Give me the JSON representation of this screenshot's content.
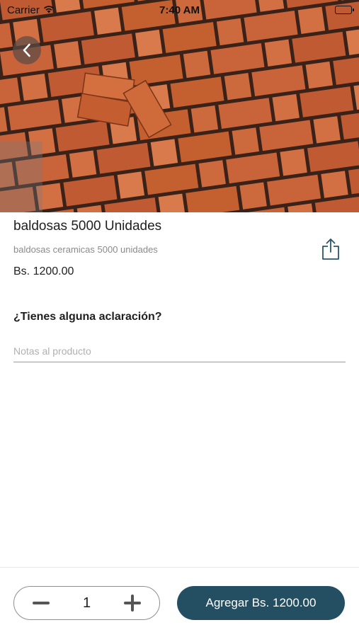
{
  "status_bar": {
    "carrier": "Carrier",
    "time": "7:40 AM",
    "icons": [
      "wifi-icon",
      "battery-icon"
    ]
  },
  "hero": {
    "image": "clay brick paving tiles photo"
  },
  "product": {
    "title": "baldosas 5000 Unidades",
    "description": "baldosas ceramicas 5000 unidades",
    "price": "Bs. 1200.00"
  },
  "notes": {
    "heading": "¿Tienes alguna aclaración?",
    "placeholder": "Notas al producto",
    "value": ""
  },
  "cart": {
    "quantity": "1",
    "add_label": "Agregar Bs. 1200.00"
  },
  "colors": {
    "accent": "#244f62",
    "share_icon": "#2b5569"
  }
}
